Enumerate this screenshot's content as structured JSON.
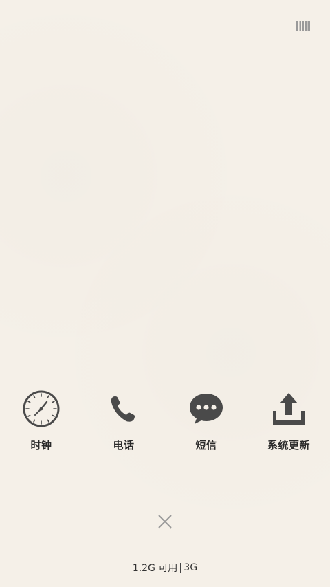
{
  "header": {
    "manage_icon": "bars-manage-icon"
  },
  "apps": [
    {
      "label": "时钟",
      "icon": "clock-icon"
    },
    {
      "label": "电话",
      "icon": "phone-icon"
    },
    {
      "label": "短信",
      "icon": "message-bubble-icon"
    },
    {
      "label": "系统更新",
      "icon": "upload-update-icon"
    }
  ],
  "close": {
    "icon": "close-icon"
  },
  "memory": {
    "available": "1.2G 可用",
    "total": "3G"
  },
  "colors": {
    "background": "#f5f0e8",
    "icon": "#4a4a4a",
    "label": "#2a2a2a"
  }
}
